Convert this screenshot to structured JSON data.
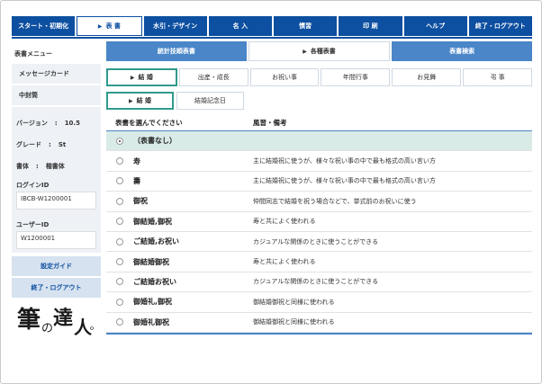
{
  "topnav": [
    {
      "label": "スタート・初期化",
      "active": false
    },
    {
      "label": "表 書",
      "active": true
    },
    {
      "label": "水引・デザイン",
      "active": false
    },
    {
      "label": "名 入",
      "active": false
    },
    {
      "label": "慣習",
      "active": false
    },
    {
      "label": "印 刷",
      "active": false
    },
    {
      "label": "ヘルプ",
      "active": false
    },
    {
      "label": "終了・ログアウト",
      "active": false
    }
  ],
  "sidebar": {
    "title": "表書メニュー",
    "items": [
      "メッセージカード",
      "中封筒"
    ],
    "version_label": "バージョン",
    "version_sep": ":",
    "version": "10.5",
    "grade_label": "グレード",
    "grade_sep": ":",
    "grade": "St",
    "font_label": "書体",
    "font_sep": ":",
    "font": "楷書体",
    "login_label": "ログインID",
    "login_value": "IBCB-W1200001",
    "user_label": "ユーザーID",
    "user_value": "W1200001",
    "settings_guide": "設定ガイド",
    "logout": "終了・ログアウト",
    "logo_text": "筆の達人"
  },
  "subtabs": [
    {
      "label": "統計技順表書",
      "active": false
    },
    {
      "label": "各種表書",
      "active": true
    },
    {
      "label": "表書検索",
      "active": false
    }
  ],
  "categories": [
    {
      "label": "結 婚",
      "active": true
    },
    {
      "label": "出産・成長",
      "active": false
    },
    {
      "label": "お祝い事",
      "active": false
    },
    {
      "label": "年間行事",
      "active": false
    },
    {
      "label": "お見舞",
      "active": false
    },
    {
      "label": "弔 事",
      "active": false
    }
  ],
  "subcategories": [
    {
      "label": "結 婚",
      "active": true
    },
    {
      "label": "結婚記念日",
      "active": false
    }
  ],
  "table": {
    "header_name": "表書を選んでください",
    "header_desc": "風習・備考",
    "rows": [
      {
        "name": "（表書なし）",
        "desc": "",
        "selected": true
      },
      {
        "name": "寿",
        "desc": "主に結婚祝に使うが、様々な祝い事の中で最も格式の高い言い方",
        "selected": false
      },
      {
        "name": "壽",
        "desc": "主に結婚祝に使うが、様々な祝い事の中で最も格式の高い言い方",
        "selected": false
      },
      {
        "name": "御祝",
        "desc": "仲間同志で結婚を祝う場合などで、挙式前のお祝いに使う",
        "selected": false
      },
      {
        "name": "御結婚,御祝",
        "desc": "寿と共によく使われる",
        "selected": false
      },
      {
        "name": "ご結婚,お祝い",
        "desc": "カジュアルな関係のときに使うことができる",
        "selected": false
      },
      {
        "name": "御結婚御祝",
        "desc": "寿と共によく使われる",
        "selected": false
      },
      {
        "name": "ご結婚お祝い",
        "desc": "カジュアルな関係のときに使うことができる",
        "selected": false
      },
      {
        "name": "御婚礼,御祝",
        "desc": "御結婚御祝と同様に使われる",
        "selected": false
      },
      {
        "name": "御婚礼御祝",
        "desc": "御結婚御祝と同様に使われる",
        "selected": false
      }
    ]
  },
  "colors": {
    "nav_blue": "#0d4fa0",
    "tab_blue": "#4a86c8",
    "accent_teal": "#2f9a8c",
    "selected_row": "#d9ebe7"
  }
}
